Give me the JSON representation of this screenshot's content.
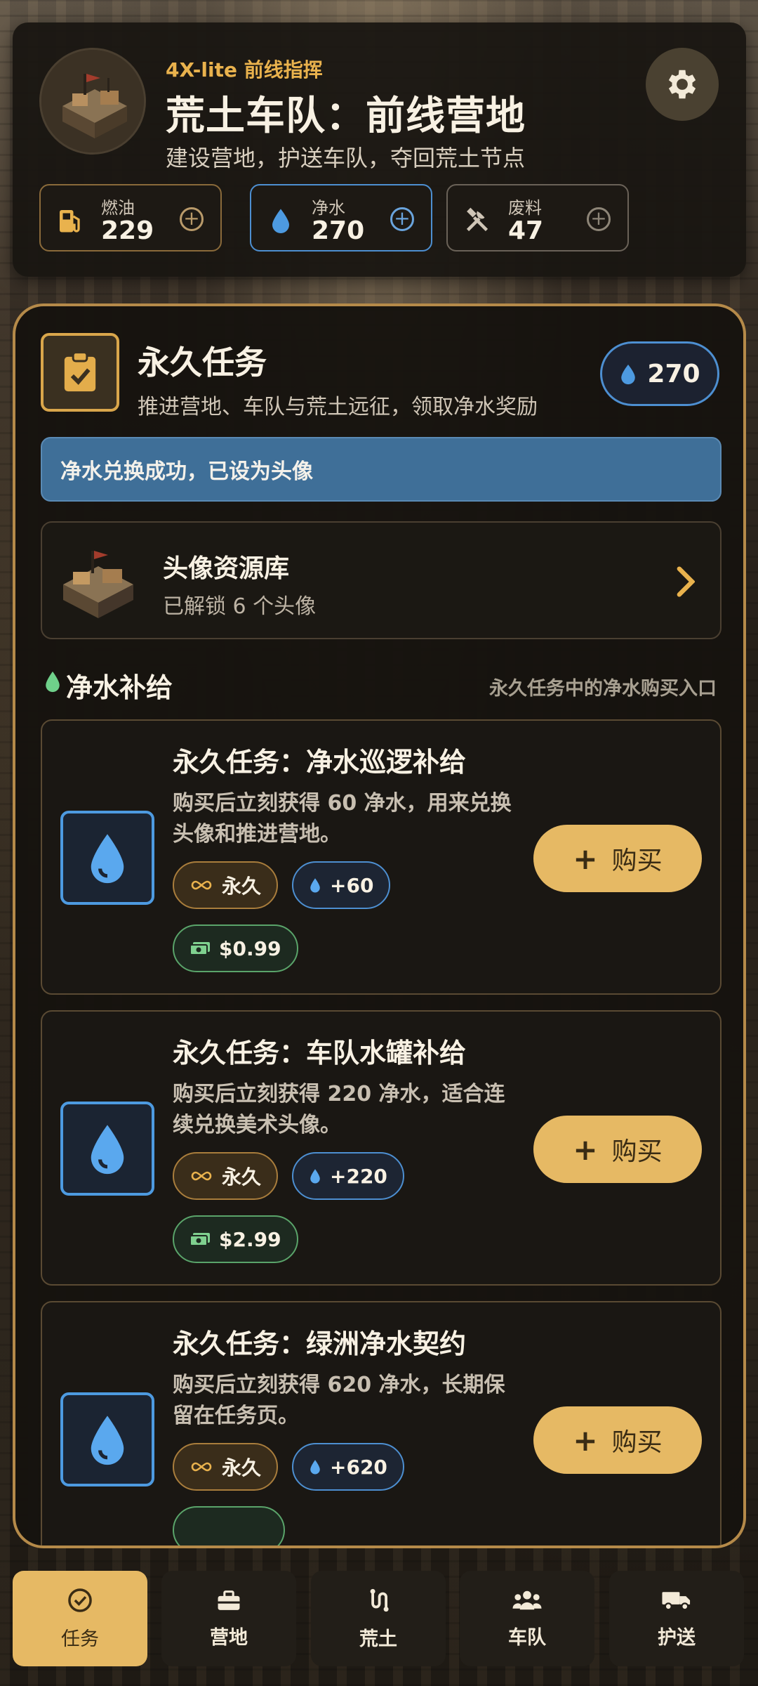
{
  "header": {
    "eyebrow": "4X-lite 前线指挥",
    "title": "荒土车队：前线营地",
    "subtitle": "建设营地，护送车队，夺回荒土节点",
    "resources": [
      {
        "label": "燃油",
        "value": "229",
        "icon": "fuel-icon",
        "color": "#e9b24d"
      },
      {
        "label": "净水",
        "value": "270",
        "icon": "water-drop-icon",
        "color": "#4d9ae0"
      },
      {
        "label": "废料",
        "value": "47",
        "icon": "tools-icon",
        "color": "#cfc5b6"
      }
    ],
    "add_symbol": "+"
  },
  "panel": {
    "title": "永久任务",
    "subtitle": "推进营地、车队与荒土远征，领取净水奖励",
    "water_balance": "270",
    "toast": "净水兑换成功，已设为头像",
    "library": {
      "title": "头像资源库",
      "subtitle": "已解锁 6 个头像"
    },
    "section": {
      "title": "净水补给",
      "hint": "永久任务中的净水购买入口"
    },
    "offers": [
      {
        "title": "永久任务：净水巡逻补给",
        "desc": "购买后立刻获得 60 净水，用来兑换头像和推进营地。",
        "perm": "永久",
        "gain": "+60",
        "price": "$0.99",
        "buy": "购买"
      },
      {
        "title": "永久任务：车队水罐补给",
        "desc": "购买后立刻获得 220 净水，适合连续兑换美术头像。",
        "perm": "永久",
        "gain": "+220",
        "price": "$2.99",
        "buy": "购买"
      },
      {
        "title": "永久任务：绿洲净水契约",
        "desc": "购买后立刻获得 620 净水，长期保留在任务页。",
        "perm": "永久",
        "gain": "+620",
        "price": "",
        "buy": "购买"
      }
    ]
  },
  "tabs": [
    {
      "label": "任务",
      "icon": "check-circle-icon",
      "active": true
    },
    {
      "label": "营地",
      "icon": "toolbox-icon",
      "active": false
    },
    {
      "label": "荒土",
      "icon": "route-icon",
      "active": false
    },
    {
      "label": "车队",
      "icon": "users-icon",
      "active": false
    },
    {
      "label": "护送",
      "icon": "truck-icon",
      "active": false
    }
  ],
  "colors": {
    "accent_gold": "#e6b964",
    "water_blue": "#4d9ae0",
    "price_green": "#5aa46a",
    "panel_border": "#b58a49"
  }
}
